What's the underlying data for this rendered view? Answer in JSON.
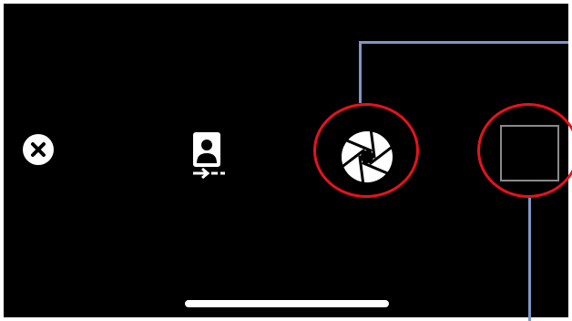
{
  "camera_toolbar": {
    "close_button": {
      "icon": "close-circle-icon"
    },
    "flip_camera_button": {
      "icon": "portrait-flip-icon"
    },
    "shutter_button": {
      "icon": "aperture-icon"
    },
    "square_button": {
      "icon": "square-outline-icon"
    }
  },
  "annotations": {
    "highlight_color": "#e8121c",
    "connector_color": "#7f97c4"
  },
  "colors": {
    "background": "#000000",
    "icon": "#ffffff",
    "square_border": "#8a8a8a"
  }
}
